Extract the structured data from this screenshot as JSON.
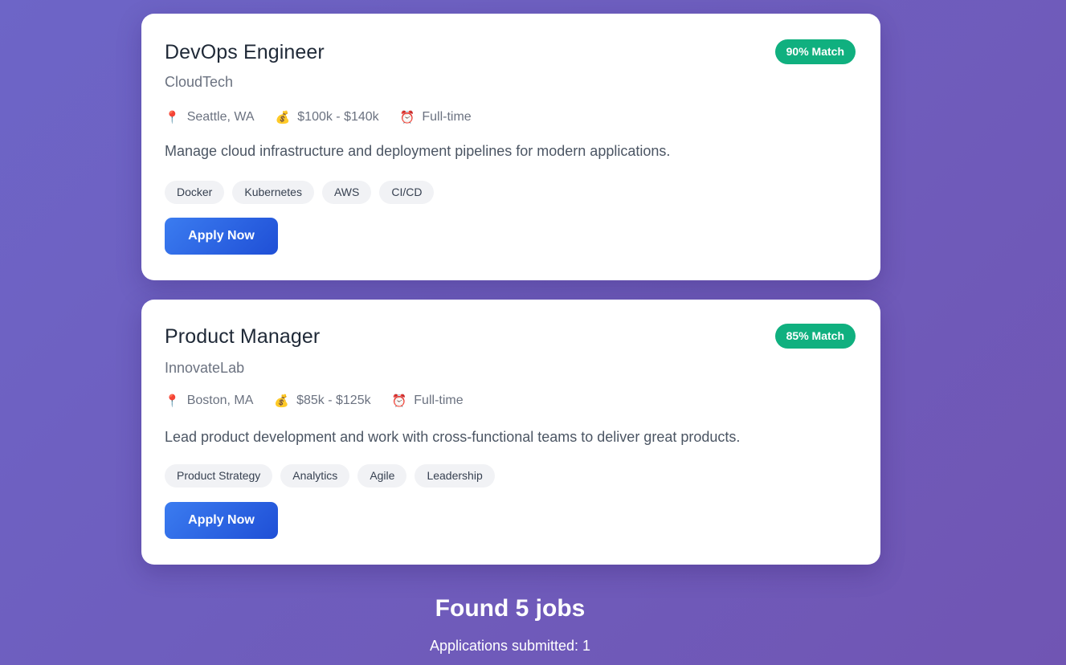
{
  "jobs": [
    {
      "title": "DevOps Engineer",
      "company": "CloudTech",
      "match": "90% Match",
      "location": "Seattle, WA",
      "salary": "$100k - $140k",
      "type": "Full-time",
      "description": "Manage cloud infrastructure and deployment pipelines for modern applications.",
      "tags": [
        "Docker",
        "Kubernetes",
        "AWS",
        "CI/CD"
      ],
      "apply_label": "Apply Now"
    },
    {
      "title": "Product Manager",
      "company": "InnovateLab",
      "match": "85% Match",
      "location": "Boston, MA",
      "salary": "$85k - $125k",
      "type": "Full-time",
      "description": "Lead product development and work with cross-functional teams to deliver great products.",
      "tags": [
        "Product Strategy",
        "Analytics",
        "Agile",
        "Leadership"
      ],
      "apply_label": "Apply Now"
    }
  ],
  "icons": {
    "location": "pin-icon",
    "salary": "money-bag-icon",
    "type": "alarm-clock-icon"
  },
  "summary": {
    "found": "Found 5 jobs",
    "applications": "Applications submitted: 1"
  },
  "colors": {
    "background_start": "#6d65c7",
    "background_end": "#7055b3",
    "match_badge": "#10b07f",
    "apply_button": "#2f66e6"
  }
}
